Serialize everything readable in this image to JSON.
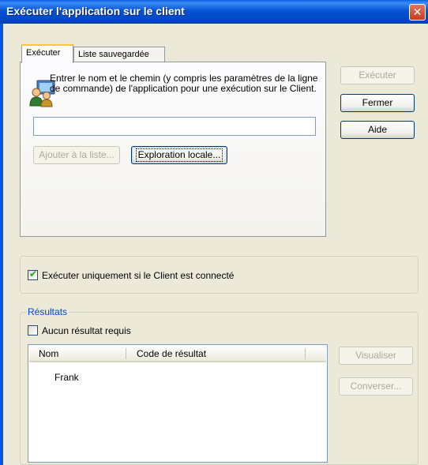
{
  "window": {
    "title": "Exécuter l'application sur le client",
    "close_glyph": "✕"
  },
  "tabs": [
    {
      "label": "Exécuter",
      "active": true
    },
    {
      "label": "Liste sauvegardée",
      "active": false
    }
  ],
  "panel": {
    "instruction": "Entrer le nom et le chemin (y compris les paramètres de la ligne de commande) de l'application pour une exécution sur le Client.",
    "command_value": "",
    "add_to_list_label": "Ajouter à la liste...",
    "browse_local_label": "Exploration locale..."
  },
  "buttons": {
    "run": "Exécuter",
    "close": "Fermer",
    "help": "Aide",
    "view": "Visualiser",
    "converse": "Converser..."
  },
  "options": {
    "run_if_connected": {
      "label": "Exécuter uniquement si le Client est connecté",
      "checked": true
    }
  },
  "results": {
    "group_label": "Résultats",
    "no_result_required": {
      "label": "Aucun résultat requis",
      "checked": false
    },
    "columns": [
      "Nom",
      "Code de résultat"
    ],
    "rows": [
      {
        "name": "Frank",
        "code": ""
      }
    ]
  }
}
